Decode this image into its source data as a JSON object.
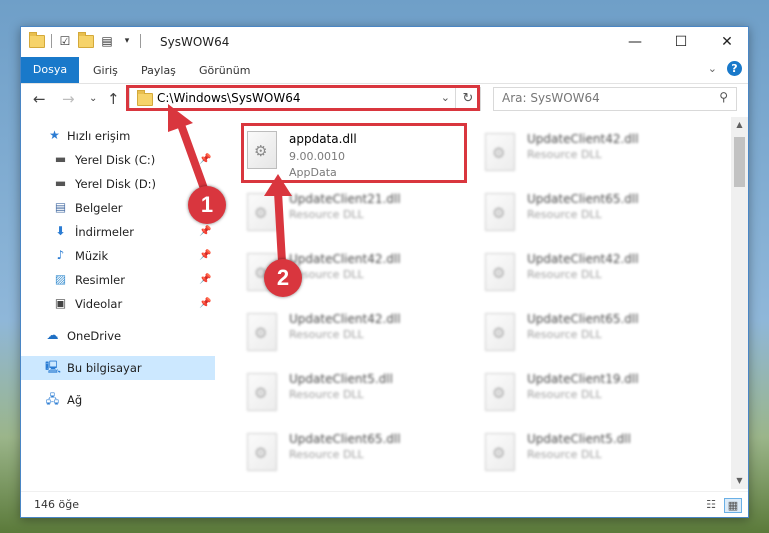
{
  "window": {
    "title": "SysWOW64"
  },
  "ribbon": {
    "tabs": [
      "Dosya",
      "Giriş",
      "Paylaş",
      "Görünüm"
    ]
  },
  "address": {
    "path": "C:\\Windows\\SysWOW64"
  },
  "search": {
    "placeholder": "Ara: SysWOW64"
  },
  "sidebar": {
    "quick_access": "Hızlı erişim",
    "items": [
      {
        "label": "Yerel Disk (C:)",
        "icon": "drive-icon",
        "pinned": true
      },
      {
        "label": "Yerel Disk (D:)",
        "icon": "drive-icon",
        "pinned": false
      },
      {
        "label": "Belgeler",
        "icon": "document-icon",
        "pinned": true
      },
      {
        "label": "İndirmeler",
        "icon": "download-icon",
        "pinned": true
      },
      {
        "label": "Müzik",
        "icon": "music-icon",
        "pinned": true
      },
      {
        "label": "Resimler",
        "icon": "picture-icon",
        "pinned": true
      },
      {
        "label": "Videolar",
        "icon": "video-icon",
        "pinned": true
      }
    ],
    "onedrive": "OneDrive",
    "this_pc": "Bu bilgisayar",
    "network": "Ağ"
  },
  "files": {
    "featured": {
      "name": "appdata.dll",
      "version": "9.00.0010",
      "description": "AppData"
    },
    "others": [
      {
        "name": "UpdateClient42.dll",
        "type": "Resource DLL"
      },
      {
        "name": "UpdateClient21.dll",
        "type": "Resource DLL"
      },
      {
        "name": "UpdateClient65.dll",
        "type": "Resource DLL"
      },
      {
        "name": "UpdateClient42.dll",
        "type": "Resource DLL"
      },
      {
        "name": "UpdateClient42.dll",
        "type": "Resource DLL"
      },
      {
        "name": "UpdateClient42.dll",
        "type": "Resource DLL"
      },
      {
        "name": "UpdateClient65.dll",
        "type": "Resource DLL"
      },
      {
        "name": "UpdateClient5.dll",
        "type": "Resource DLL"
      },
      {
        "name": "UpdateClient19.dll",
        "type": "Resource DLL"
      },
      {
        "name": "UpdateClient65.dll",
        "type": "Resource DLL"
      },
      {
        "name": "UpdateClient5.dll",
        "type": "Resource DLL"
      }
    ]
  },
  "status": {
    "count": "146 öğe"
  },
  "annotations": {
    "badge1": "1",
    "badge2": "2",
    "color": "#d9363e"
  }
}
